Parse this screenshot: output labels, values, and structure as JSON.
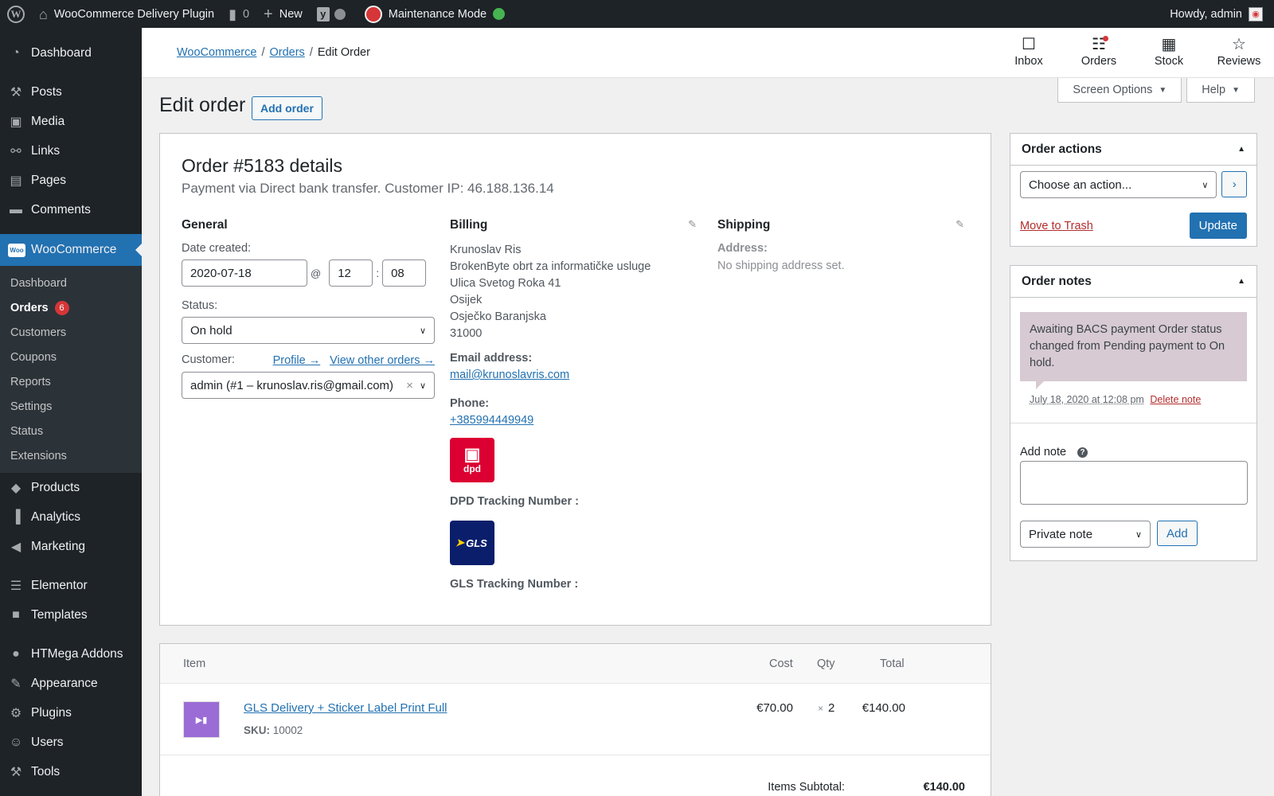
{
  "adminbar": {
    "site_name": "WooCommerce Delivery Plugin",
    "comments_count": "0",
    "new_label": "New",
    "maintenance_label": "Maintenance Mode",
    "howdy": "Howdy, admin"
  },
  "sidebar": {
    "items_top": [
      {
        "label": "Dashboard",
        "icon": "◔"
      }
    ],
    "items_content": [
      {
        "label": "Posts",
        "icon": "⚒"
      },
      {
        "label": "Media",
        "icon": "▣"
      },
      {
        "label": "Links",
        "icon": "⚯"
      },
      {
        "label": "Pages",
        "icon": "▤"
      },
      {
        "label": "Comments",
        "icon": "▬"
      }
    ],
    "woocommerce": {
      "label": "WooCommerce",
      "icon": "Woo"
    },
    "woo_sub": [
      {
        "label": "Dashboard"
      },
      {
        "label": "Orders",
        "badge": "6"
      },
      {
        "label": "Customers"
      },
      {
        "label": "Coupons"
      },
      {
        "label": "Reports"
      },
      {
        "label": "Settings"
      },
      {
        "label": "Status"
      },
      {
        "label": "Extensions"
      }
    ],
    "items_after": [
      {
        "label": "Products",
        "icon": "◆"
      },
      {
        "label": "Analytics",
        "icon": "▐"
      },
      {
        "label": "Marketing",
        "icon": "◀"
      }
    ],
    "items_builder": [
      {
        "label": "Elementor",
        "icon": "☰"
      },
      {
        "label": "Templates",
        "icon": "■"
      }
    ],
    "items_bottom": [
      {
        "label": "HTMega Addons",
        "icon": "●"
      },
      {
        "label": "Appearance",
        "icon": "✎"
      },
      {
        "label": "Plugins",
        "icon": "⚙"
      },
      {
        "label": "Users",
        "icon": "☺"
      },
      {
        "label": "Tools",
        "icon": "⚒"
      }
    ]
  },
  "header": {
    "breadcrumb": [
      "WooCommerce",
      "Orders",
      "Edit Order"
    ],
    "icons": [
      {
        "label": "Inbox",
        "icon": "☐"
      },
      {
        "label": "Orders",
        "icon": "☷"
      },
      {
        "label": "Stock",
        "icon": "▦"
      },
      {
        "label": "Reviews",
        "icon": "☆"
      }
    ],
    "screen_options": "Screen Options",
    "help": "Help"
  },
  "page": {
    "title": "Edit order",
    "add_order": "Add order"
  },
  "order": {
    "heading": "Order #5183 details",
    "subheading": "Payment via Direct bank transfer. Customer IP: 46.188.136.14",
    "general": {
      "title": "General",
      "date_label": "Date created:",
      "date": "2020-07-18",
      "at": "@",
      "hour": "12",
      "colon": ":",
      "minute": "08",
      "status_label": "Status:",
      "status": "On hold",
      "customer_label": "Customer:",
      "profile_link": "Profile →",
      "other_orders_link": "View other orders →",
      "customer": "admin (#1 – krunoslav.ris@gmail.com)"
    },
    "billing": {
      "title": "Billing",
      "address": [
        "Krunoslav Ris",
        "BrokenByte obrt za informatičke usluge",
        "Ulica Svetog Roka 41",
        "Osijek",
        "Osječko Baranjska",
        "31000"
      ],
      "email_label": "Email address:",
      "email": "mail@krunoslavris.com",
      "phone_label": "Phone:",
      "phone": "+385994449949",
      "dpd_logo": "dpd",
      "dpd_tracking_label": "DPD Tracking Number :",
      "gls_logo": "GLS",
      "gls_tracking_label": "GLS Tracking Number :"
    },
    "shipping": {
      "title": "Shipping",
      "address_label": "Address:",
      "address_value": "No shipping address set."
    }
  },
  "items": {
    "headers": {
      "item": "Item",
      "cost": "Cost",
      "qty": "Qty",
      "total": "Total"
    },
    "rows": [
      {
        "name": "GLS Delivery + Sticker Label Print Full",
        "sku_label": "SKU:",
        "sku": "10002",
        "cost": "€70.00",
        "qty_x": "×",
        "qty": "2",
        "total": "€140.00"
      }
    ],
    "subtotal_label": "Items Subtotal:",
    "subtotal_value": "€140.00"
  },
  "order_actions": {
    "title": "Order actions",
    "select": "Choose an action...",
    "go": "›",
    "trash": "Move to Trash",
    "update": "Update"
  },
  "order_notes": {
    "title": "Order notes",
    "note_text": "Awaiting BACS payment Order status changed from Pending payment to On hold.",
    "note_date": "July 18, 2020 at 12:08 pm",
    "delete_note": "Delete note",
    "add_note_label": "Add note",
    "help_icon": "?",
    "note_type": "Private note",
    "add_button": "Add"
  },
  "colors": {
    "admin_dark": "#1d2327",
    "accent": "#2271b1",
    "note_bg": "#d7cad2",
    "danger": "#b32d2e"
  }
}
